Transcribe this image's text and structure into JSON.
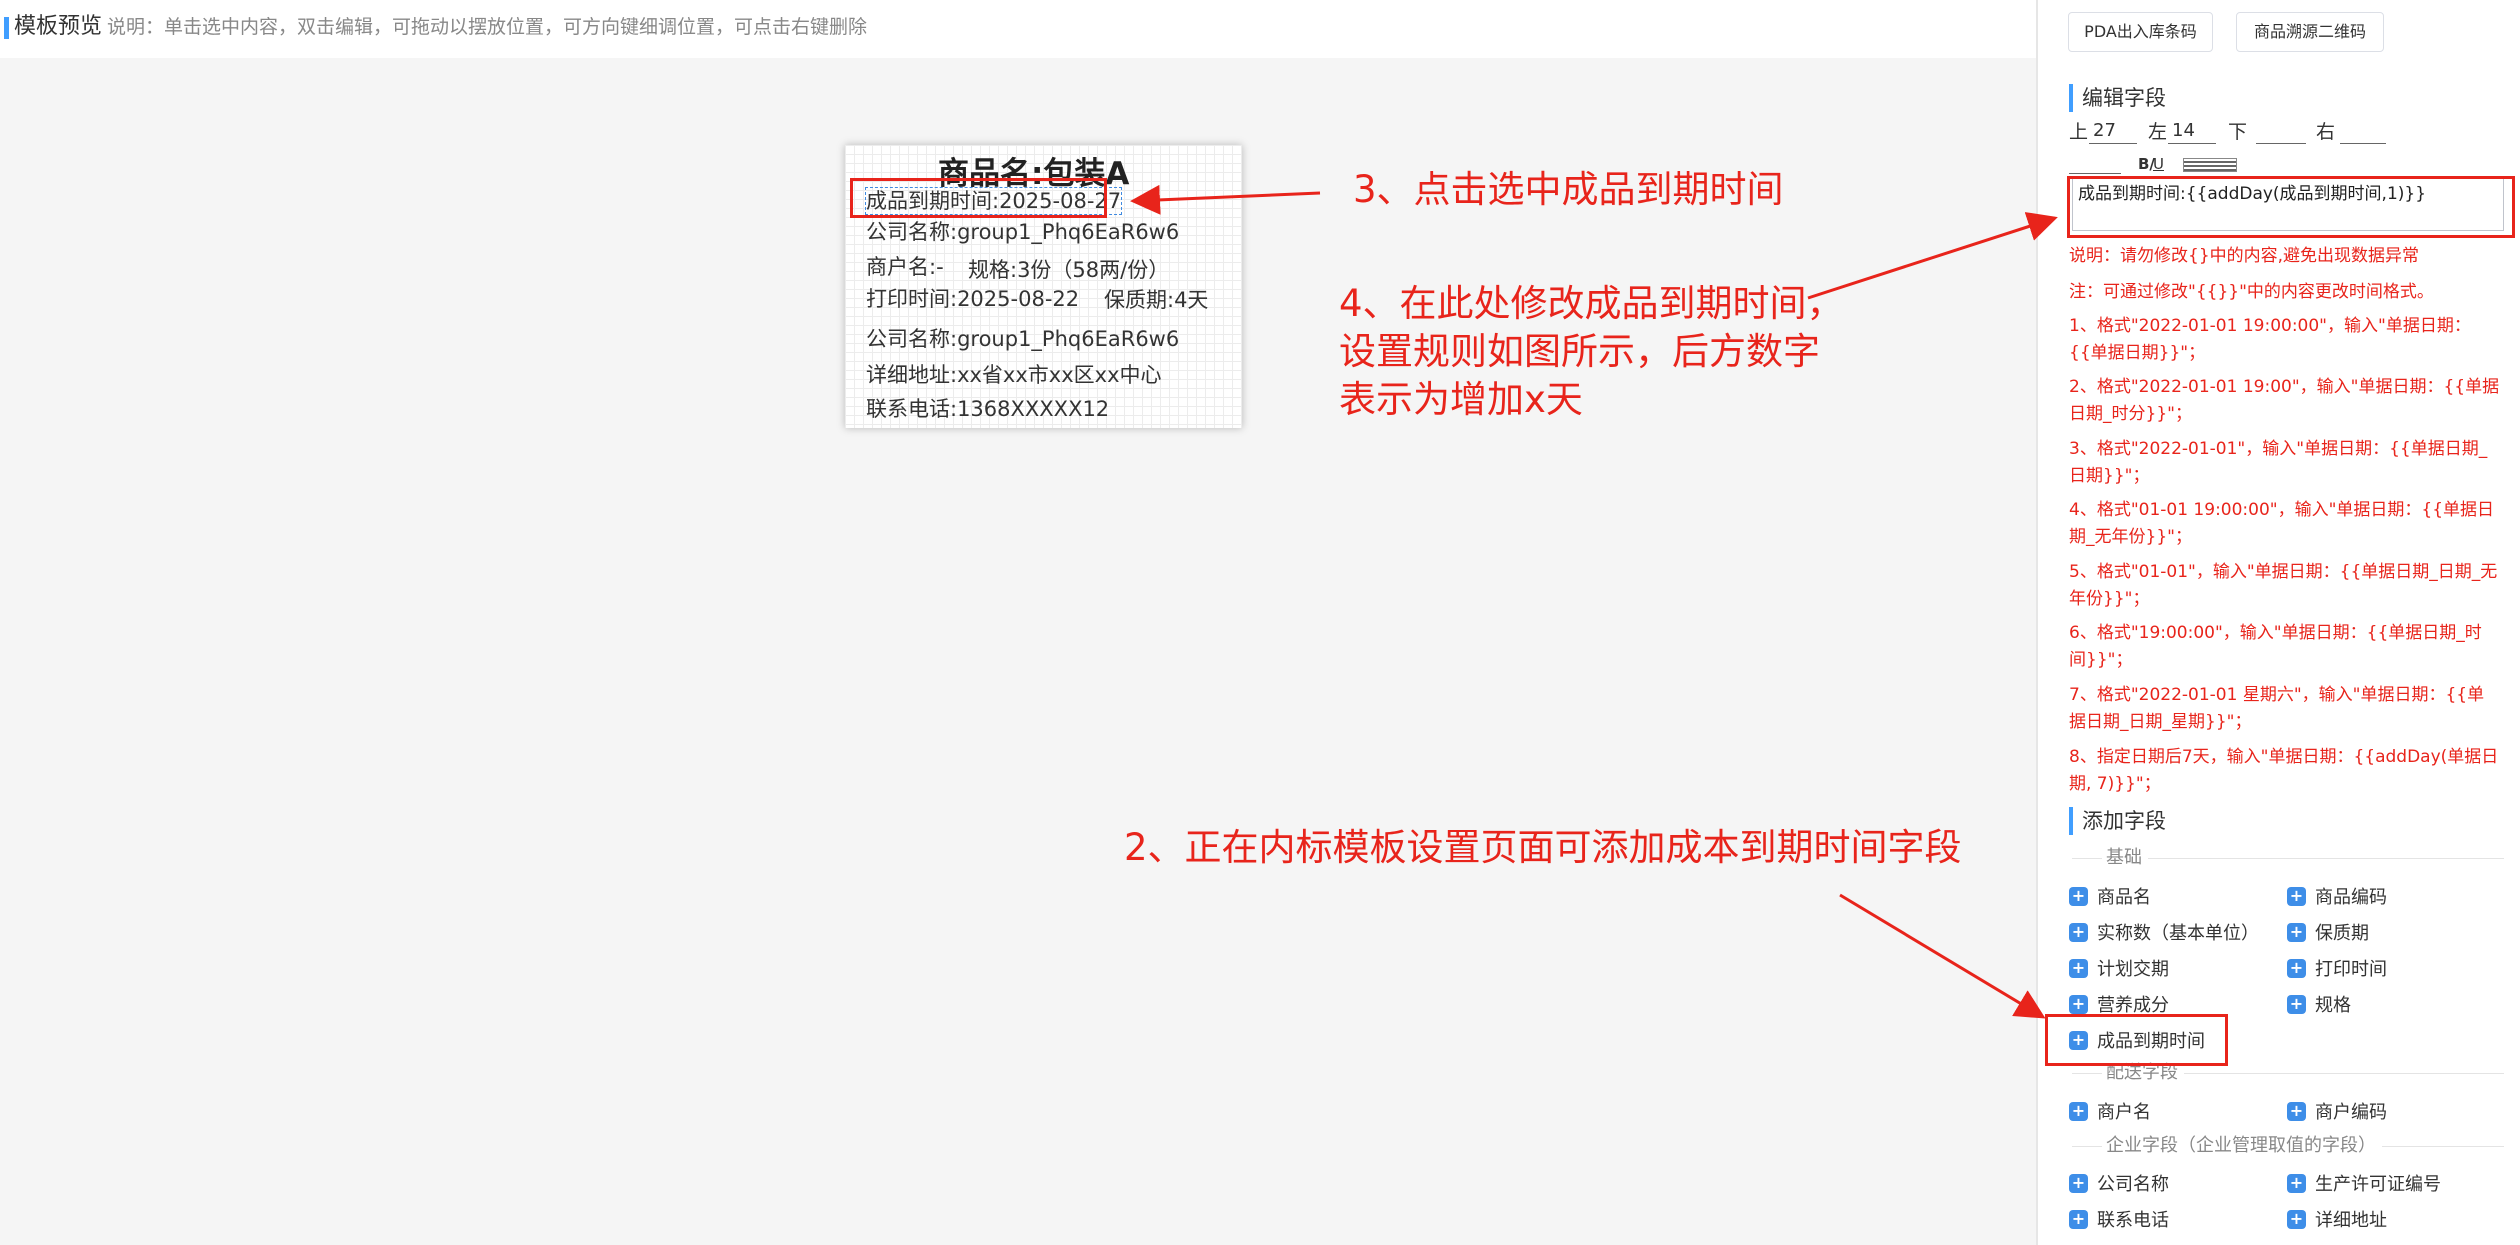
{
  "preview": {
    "title": "模板预览",
    "description": "说明：单击选中内容，双击编辑，可拖动以摆放位置，可方向键细调位置，可点击右键删除"
  },
  "label": {
    "title": "商品名:包装A",
    "expiry": "成品到期时间:2025-08-27",
    "company1": "公司名称:group1_Phq6EaR6w6",
    "merchant": "商户名:-",
    "spec": "规格:3份（58两/份）",
    "print_time": "打印时间:2025-08-22",
    "shelf_life": "保质期:4天",
    "company2": "公司名称:group1_Phq6EaR6w6",
    "address": "详细地址:xx省xx市xx区xx中心",
    "phone": "联系电话:1368XXXXX12"
  },
  "annotations": {
    "step3": "3、点击选中成品到期时间",
    "step4_line1": "4、在此处修改成品到期时间，",
    "step4_line2": "设置规则如图所示，后方数字",
    "step4_line3": "表示为增加x天",
    "step2": "2、正在内标模板设置页面可添加成本到期时间字段"
  },
  "toolbar": {
    "pda_button": "PDA出入库条码",
    "trace_button": "商品溯源二维码"
  },
  "edit": {
    "section_title": "编辑字段",
    "top_label": "上",
    "top_value": "27",
    "left_label": "左",
    "left_value": "14",
    "bottom_label": "下",
    "bottom_value": "",
    "right_label": "右",
    "right_value": "",
    "format_bold_italic": "B/",
    "format_underline": "U",
    "textarea_value": "成品到期时间:{{addDay(成品到期时间,1)}}",
    "notes": [
      "说明：请勿修改{}中的内容,避免出现数据异常",
      "注：可通过修改\"{{}}\"中的内容更改时间格式。",
      "1、格式\"2022-01-01 19:00:00\"，输入\"单据日期：{{单据日期}}\"；",
      "2、格式\"2022-01-01 19:00\"，输入\"单据日期：{{单据日期_时分}}\"；",
      "3、格式\"2022-01-01\"，输入\"单据日期：{{单据日期_日期}}\"；",
      "4、格式\"01-01 19:00:00\"，输入\"单据日期：{{单据日期_无年份}}\"；",
      "5、格式\"01-01\"，输入\"单据日期：{{单据日期_日期_无年份}}\"；",
      "6、格式\"19:00:00\"，输入\"单据日期：{{单据日期_时间}}\"；",
      "7、格式\"2022-01-01 星期六\"，输入\"单据日期：{{单据日期_日期_星期}}\"；",
      "8、指定日期后7天，输入\"单据日期：{{addDay(单据日期, 7)}}\"；"
    ]
  },
  "add": {
    "section_title": "添加字段",
    "groups": {
      "basic": "基础",
      "delivery": "配送字段",
      "enterprise": "企业字段（企业管理取值的字段）"
    },
    "basic_fields": [
      "商品名",
      "商品编码",
      "实称数（基本单位）",
      "保质期",
      "计划交期",
      "打印时间",
      "营养成分",
      "规格",
      "成品到期时间"
    ],
    "delivery_fields": [
      "商户名",
      "商户编码"
    ],
    "enterprise_fields": [
      "公司名称",
      "生产许可证编号",
      "联系电话",
      "详细地址"
    ]
  }
}
